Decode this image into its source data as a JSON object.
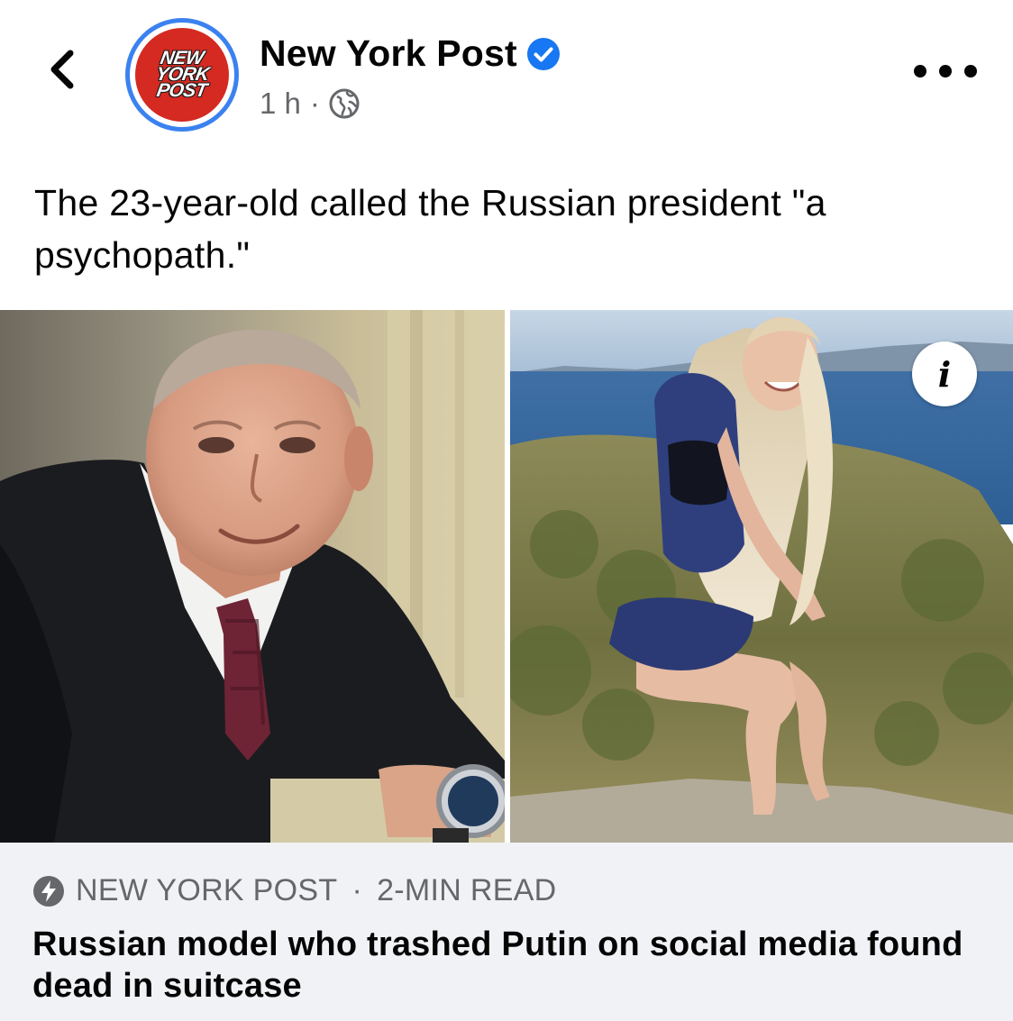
{
  "header": {
    "back_icon": "chevron-left-icon",
    "avatar_logo_lines": [
      "NEW",
      "YORK",
      "POST"
    ],
    "page_name": "New York Post",
    "verified_icon": "verified-badge-icon",
    "timestamp": "1 h",
    "separator": "·",
    "audience_icon": "globe-icon",
    "more_icon": "more-options-icon"
  },
  "post": {
    "caption": "The 23-year-old called the Russian president \"a psychopath.\""
  },
  "media": {
    "info_icon": "info-icon",
    "info_label": "i"
  },
  "link_preview": {
    "source_icon": "instant-article-bolt-icon",
    "source": "NEW YORK POST",
    "separator": "·",
    "read_time": "2-MIN READ",
    "headline": "Russian model who trashed Putin on social media found dead in suitcase"
  },
  "colors": {
    "accent_blue": "#3b82f0",
    "logo_red": "#d42a22",
    "secondary_text": "#65676b",
    "footer_bg": "#f0f2f5"
  }
}
